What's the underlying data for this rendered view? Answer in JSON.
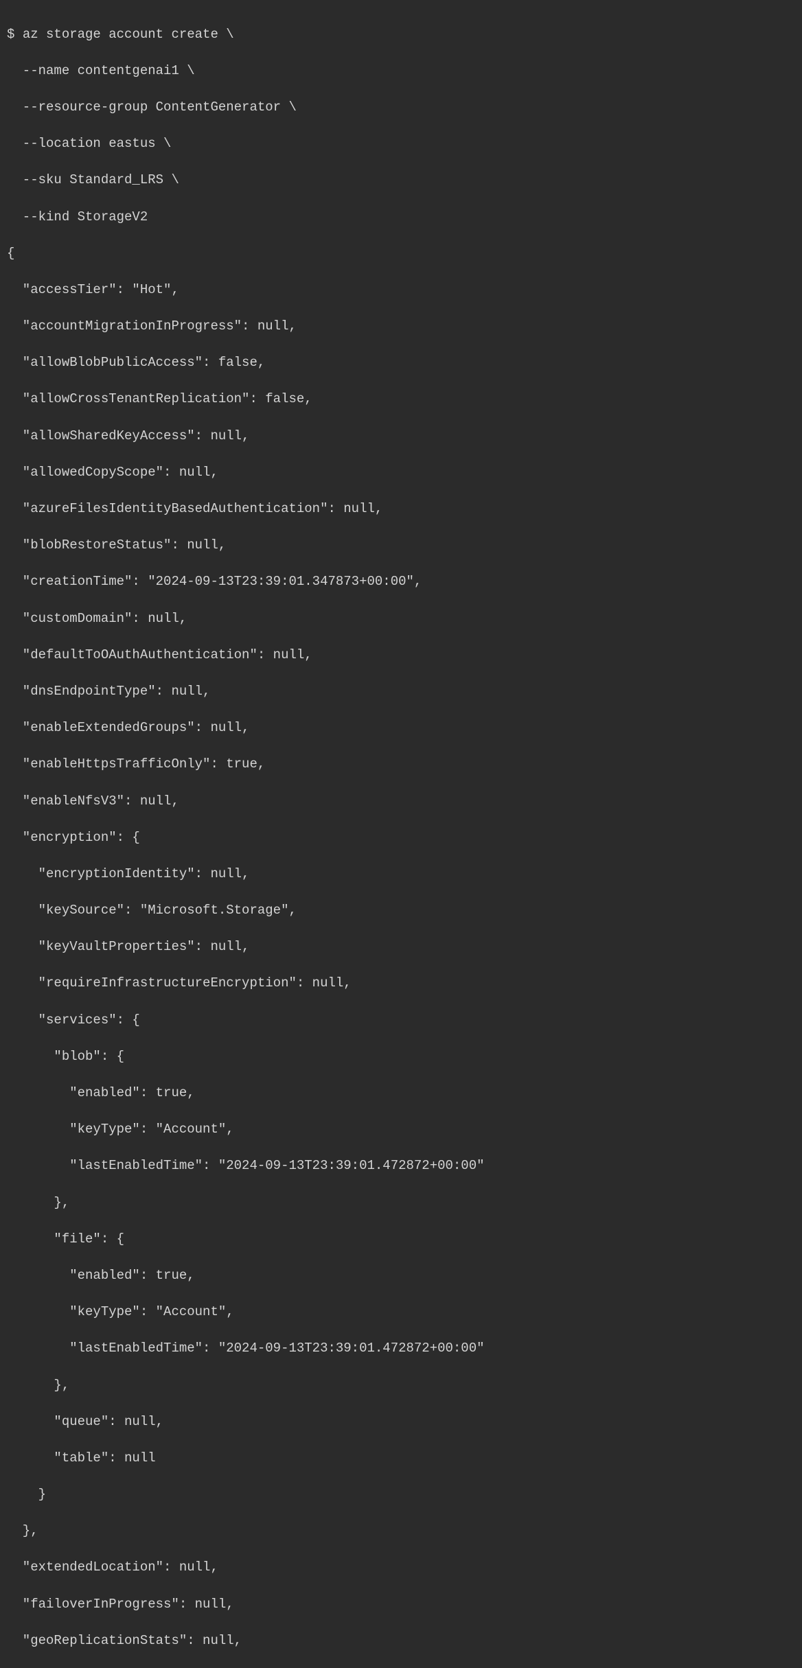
{
  "prompt": "$ ",
  "command": {
    "line1": "az storage account create \\",
    "line2": "  --name contentgenai1 \\",
    "line3": "  --resource-group ContentGenerator \\",
    "line4": "  --location eastus \\",
    "line5": "  --sku Standard_LRS \\",
    "line6": "  --kind StorageV2"
  },
  "output": {
    "line1": "{",
    "line2": "  \"accessTier\": \"Hot\",",
    "line3": "  \"accountMigrationInProgress\": null,",
    "line4": "  \"allowBlobPublicAccess\": false,",
    "line5": "  \"allowCrossTenantReplication\": false,",
    "line6": "  \"allowSharedKeyAccess\": null,",
    "line7": "  \"allowedCopyScope\": null,",
    "line8": "  \"azureFilesIdentityBasedAuthentication\": null,",
    "line9": "  \"blobRestoreStatus\": null,",
    "line10": "  \"creationTime\": \"2024-09-13T23:39:01.347873+00:00\",",
    "line11": "  \"customDomain\": null,",
    "line12": "  \"defaultToOAuthAuthentication\": null,",
    "line13": "  \"dnsEndpointType\": null,",
    "line14": "  \"enableExtendedGroups\": null,",
    "line15": "  \"enableHttpsTrafficOnly\": true,",
    "line16": "  \"enableNfsV3\": null,",
    "line17": "  \"encryption\": {",
    "line18": "    \"encryptionIdentity\": null,",
    "line19": "    \"keySource\": \"Microsoft.Storage\",",
    "line20": "    \"keyVaultProperties\": null,",
    "line21": "    \"requireInfrastructureEncryption\": null,",
    "line22": "    \"services\": {",
    "line23": "      \"blob\": {",
    "line24": "        \"enabled\": true,",
    "line25": "        \"keyType\": \"Account\",",
    "line26": "        \"lastEnabledTime\": \"2024-09-13T23:39:01.472872+00:00\"",
    "line27": "      },",
    "line28": "      \"file\": {",
    "line29": "        \"enabled\": true,",
    "line30": "        \"keyType\": \"Account\",",
    "line31": "        \"lastEnabledTime\": \"2024-09-13T23:39:01.472872+00:00\"",
    "line32": "      },",
    "line33": "      \"queue\": null,",
    "line34": "      \"table\": null",
    "line35": "    }",
    "line36": "  },",
    "line37": "  \"extendedLocation\": null,",
    "line38": "  \"failoverInProgress\": null,",
    "line39": "  \"geoReplicationStats\": null,"
  }
}
